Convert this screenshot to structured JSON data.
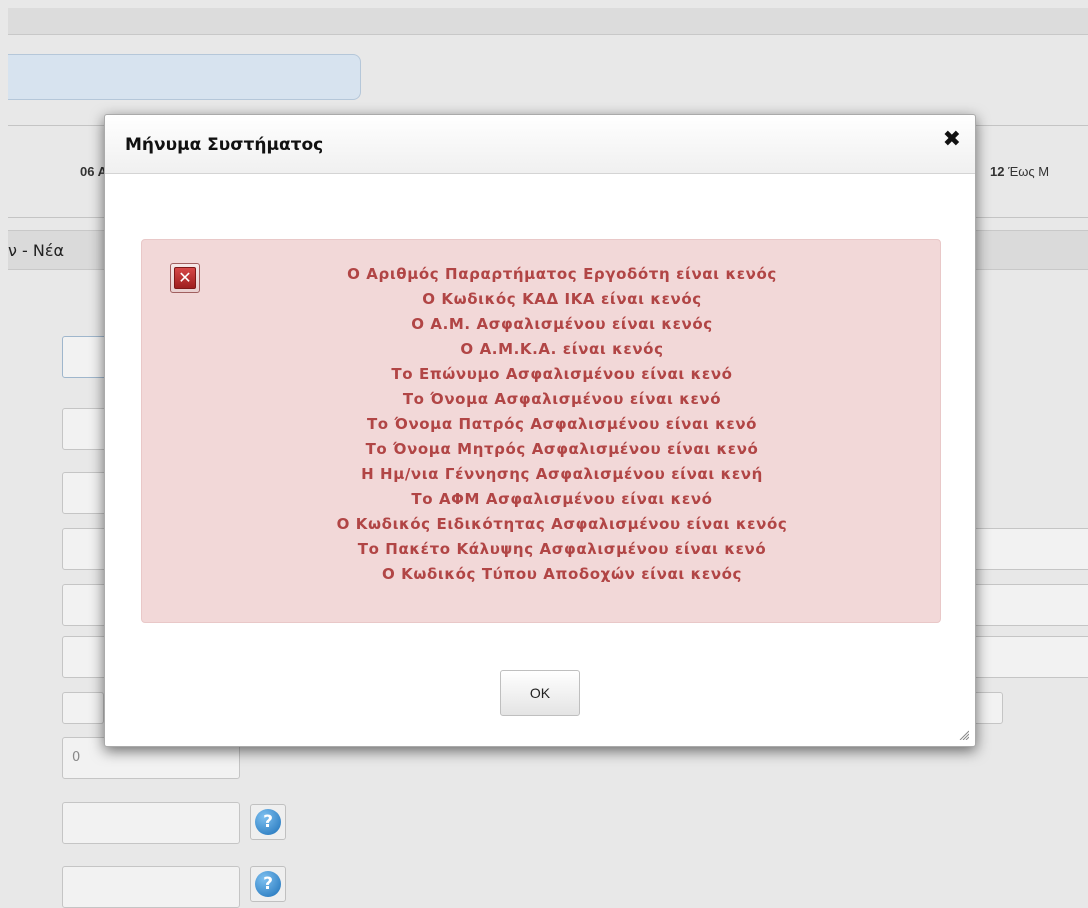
{
  "background": {
    "label_left": "06 Α",
    "label_right_num": "12",
    "label_right_text": " Έως Μ",
    "section_title": "ν - Νέα",
    "zero_field_value": "0",
    "help_icon": "?"
  },
  "dialog": {
    "title": "Μήνυμα Συστήματος",
    "close_icon": "✖",
    "error_icon": "x-box-icon",
    "errors": [
      "Ο Αριθμός Παραρτήματος Εργοδότη είναι κενός",
      "Ο Κωδικός ΚΑΔ ΙΚΑ είναι κενός",
      "Ο Α.Μ. Ασφαλισμένου είναι κενός",
      "Ο Α.Μ.Κ.Α. είναι κενός",
      "Το Επώνυμο Ασφαλισμένου είναι κενό",
      "Το Όνομα Ασφαλισμένου είναι κενό",
      "Το Όνομα Πατρός Ασφαλισμένου είναι κενό",
      "Το Όνομα Μητρός Ασφαλισμένου είναι κενό",
      "Η Ημ/νια Γέννησης Ασφαλισμένου είναι κενή",
      "Το ΑΦΜ Ασφαλισμένου είναι κενό",
      "Ο Κωδικός Ειδικότητας Ασφαλισμένου είναι κενός",
      "Το Πακέτο Κάλυψης Ασφαλισμένου είναι κενό",
      "Ο Κωδικός Τύπου Αποδοχών είναι κενός"
    ],
    "ok_label": "OK"
  },
  "colors": {
    "error_text": "#b14545",
    "error_bg": "#f2d8d8",
    "help_blue": "#1c70b8"
  }
}
